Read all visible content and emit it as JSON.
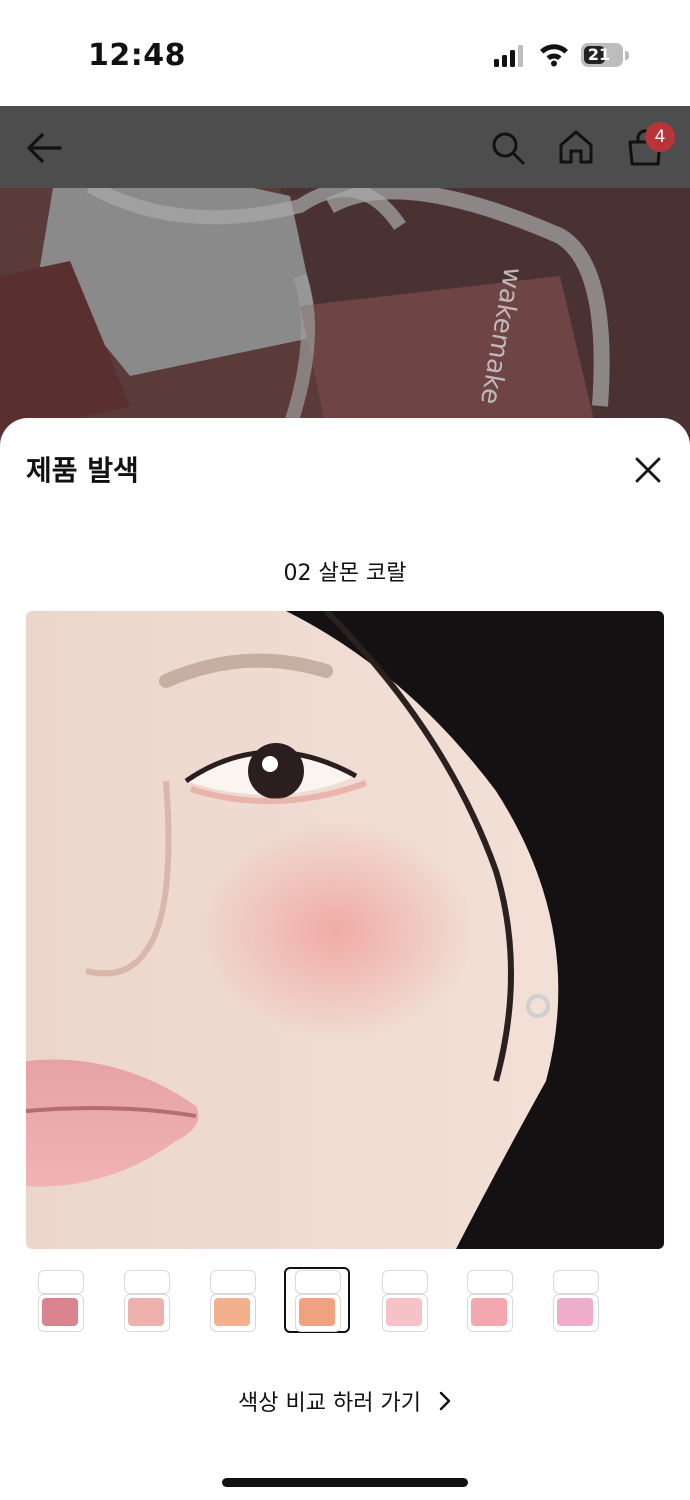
{
  "status_bar": {
    "time": "12:48",
    "battery": "21"
  },
  "nav": {
    "cart_count": "4",
    "icons": [
      "back-arrow-icon",
      "search-icon",
      "home-icon",
      "shopping-bag-icon"
    ]
  },
  "backdrop": {
    "brand_text": "wakemake"
  },
  "sheet": {
    "title": "제품 발색",
    "shade_name": "02 살몬 코랄",
    "compare_link": "색상 비교 하러 가기"
  },
  "swatches": [
    {
      "color": "#d9848f",
      "selected": false
    },
    {
      "color": "#eeb1ad",
      "selected": false
    },
    {
      "color": "#f3b08c",
      "selected": false
    },
    {
      "color": "#f0a17f",
      "selected": true
    },
    {
      "color": "#f6c2c8",
      "selected": false
    },
    {
      "color": "#f3a8b0",
      "selected": false
    },
    {
      "color": "#eeadc8",
      "selected": false
    }
  ],
  "colors": {
    "accent_badge": "#b8343b",
    "backdrop": "#4a4444"
  }
}
